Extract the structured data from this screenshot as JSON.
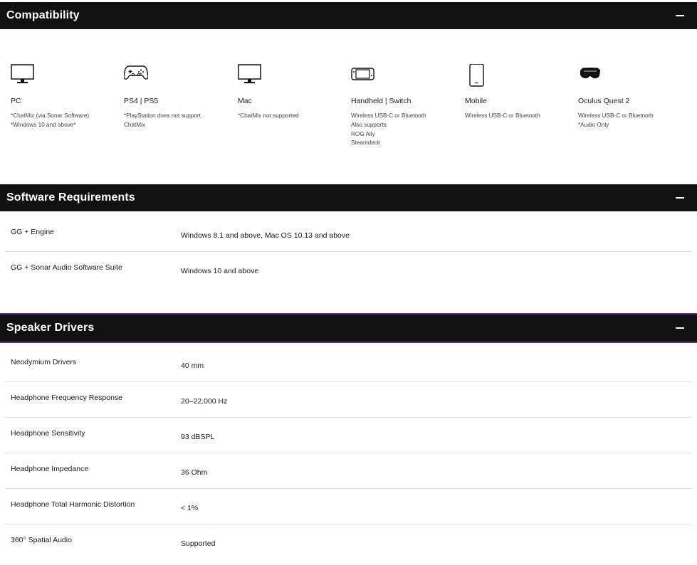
{
  "sections": {
    "compatibility": {
      "title": "Compatibility",
      "collapse_icon": "minus-icon",
      "items": [
        {
          "icon": "monitor-icon",
          "name": "PC",
          "notes": [
            "*ChatMix (via Sonar Software)",
            "*Windows 10 and above*"
          ]
        },
        {
          "icon": "gamepad-icon",
          "name": "PS4 | PS5",
          "notes": [
            "*PlayStation does not support",
            "ChatMix"
          ]
        },
        {
          "icon": "monitor-icon",
          "name": "Mac",
          "notes": [
            "*ChatMix not supported"
          ]
        },
        {
          "icon": "handheld-console-icon",
          "name": "Handheld | Switch",
          "notes": [
            "Wireless USB-C or Bluetooth",
            "Also supports:",
            "ROG Ally",
            "Steamdeck"
          ]
        },
        {
          "icon": "smartphone-icon",
          "name": "Mobile",
          "notes": [
            "Wireless USB-C or Bluetooth"
          ]
        },
        {
          "icon": "vr-headset-icon",
          "name": "Oculus Quest 2",
          "notes": [
            "Wireless USB-C or Bluetooth",
            "*Audio Only"
          ]
        }
      ]
    },
    "software": {
      "title": "Software Requirements",
      "collapse_icon": "minus-icon",
      "rows": [
        {
          "label": "GG + Engine",
          "value": "Windows 8.1 and above, Mac OS 10.13 and above"
        },
        {
          "label": "GG + Sonar Audio Software Suite",
          "value": "Windows 10 and above"
        }
      ]
    },
    "speaker": {
      "title": "Speaker Drivers",
      "collapse_icon": "minus-icon",
      "accent_color": "#5b2b8f",
      "rows": [
        {
          "label": "Neodymium Drivers",
          "value": "40 mm"
        },
        {
          "label": "Headphone Frequency Response",
          "value": "20–22,000 Hz"
        },
        {
          "label": "Headphone Sensitivity",
          "value": "93 dBSPL"
        },
        {
          "label": "Headphone Impedance",
          "value": "36 Ohm"
        },
        {
          "label": "Headphone Total Harmonic Distortion",
          "value": "< 1%"
        },
        {
          "label": "360° Spatial Audio",
          "value": "Supported"
        }
      ]
    }
  }
}
